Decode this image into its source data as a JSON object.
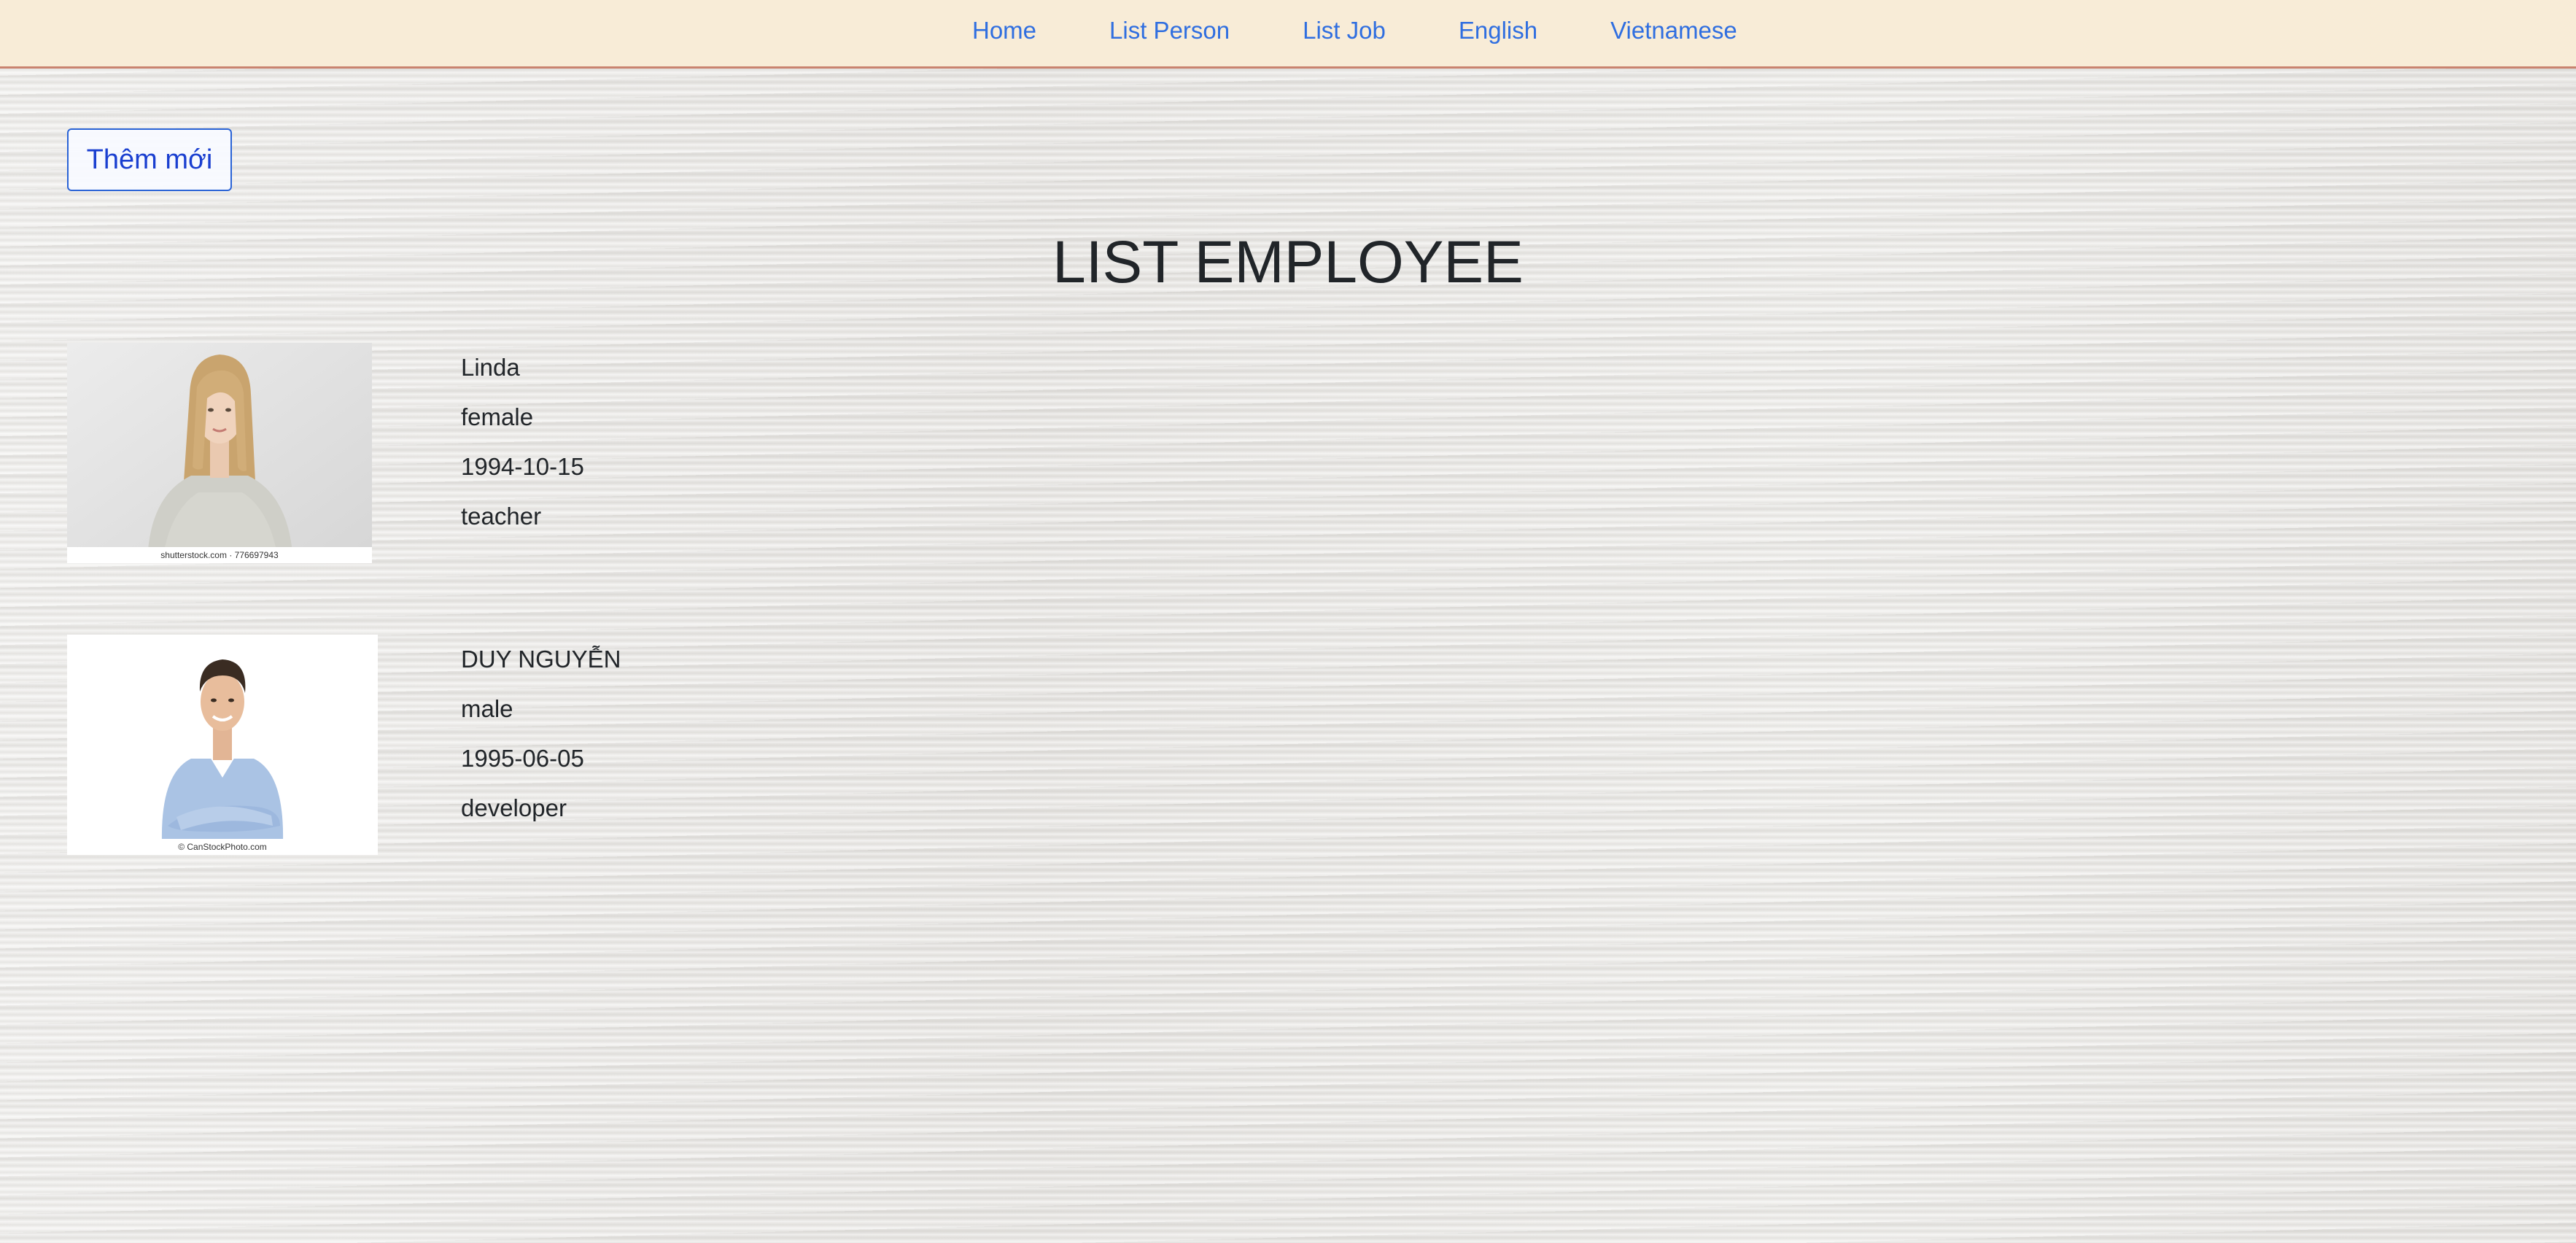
{
  "nav": {
    "links": [
      {
        "label": "Home"
      },
      {
        "label": "List Person"
      },
      {
        "label": "List Job"
      },
      {
        "label": "English"
      },
      {
        "label": "Vietnamese"
      }
    ],
    "link_color": "#2f6ee0",
    "background": "#f8ecd7"
  },
  "actions": {
    "add_label": "Thêm mới"
  },
  "page": {
    "title": "LIST EMPLOYEE"
  },
  "employees": [
    {
      "name": "Linda",
      "gender": "female",
      "birthday": "1994-10-15",
      "job": "teacher",
      "photo_caption": "shutterstock.com · 776697943"
    },
    {
      "name": "DUY NGUYỄN",
      "gender": "male",
      "birthday": "1995-06-05",
      "job": "developer",
      "photo_caption": "© CanStockPhoto.com"
    }
  ]
}
